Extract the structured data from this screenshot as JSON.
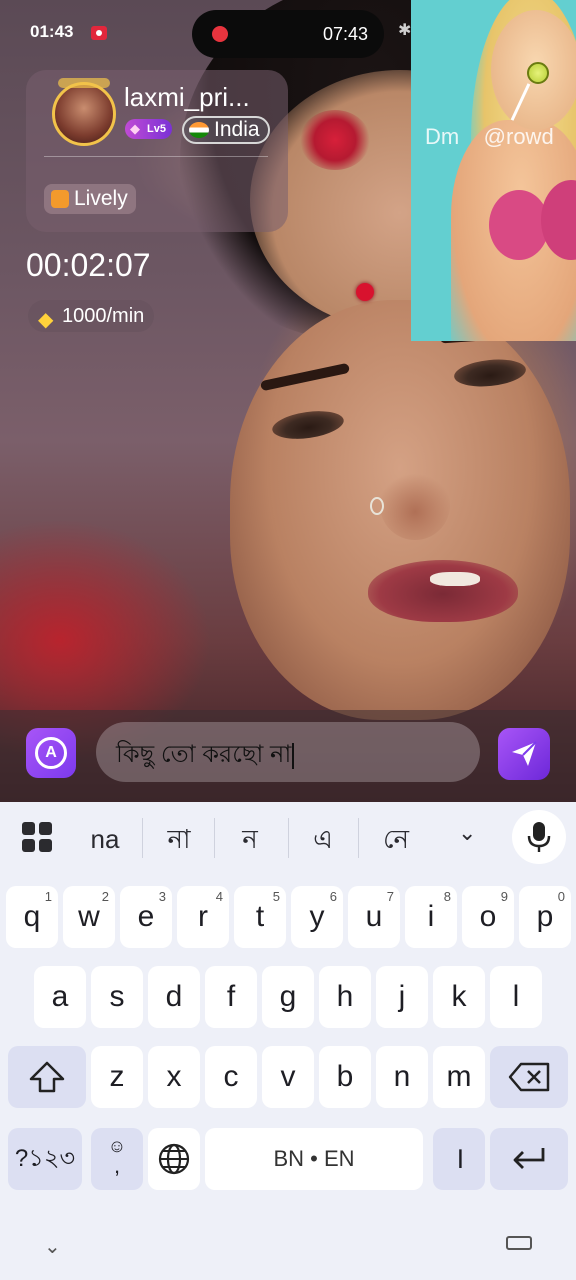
{
  "status_bar": {
    "time": "01:43",
    "call_time": "07:43"
  },
  "host": {
    "username": "laxmi_pri...",
    "level": "Lv5",
    "country": "India",
    "tag": "Lively"
  },
  "call": {
    "timer": "00:02:07",
    "rate": "1000/min"
  },
  "ad": {
    "overlay_text": "Dm    @rowd"
  },
  "input": {
    "text": "কিছু তো করছো না"
  },
  "keyboard": {
    "suggestions": [
      "na",
      "না",
      "ন",
      "এ",
      "নে"
    ],
    "row1": [
      {
        "k": "q",
        "n": "1"
      },
      {
        "k": "w",
        "n": "2"
      },
      {
        "k": "e",
        "n": "3"
      },
      {
        "k": "r",
        "n": "4"
      },
      {
        "k": "t",
        "n": "5"
      },
      {
        "k": "y",
        "n": "6"
      },
      {
        "k": "u",
        "n": "7"
      },
      {
        "k": "i",
        "n": "8"
      },
      {
        "k": "o",
        "n": "9"
      },
      {
        "k": "p",
        "n": "0"
      }
    ],
    "row2": [
      "a",
      "s",
      "d",
      "f",
      "g",
      "h",
      "j",
      "k",
      "l"
    ],
    "row3": [
      "z",
      "x",
      "c",
      "v",
      "b",
      "n",
      "m"
    ],
    "symbols_label": "?১২৩",
    "emoji_label": "☺",
    "comma_label": ",",
    "space_label": "BN • EN",
    "period_label": "।",
    "icons": [
      "apps-grid-icon",
      "chevron-down-icon",
      "mic-icon",
      "shift-icon",
      "backspace-icon",
      "globe-icon",
      "enter-icon",
      "translate-icon",
      "send-icon",
      "diamond-icon",
      "keyboard-icon"
    ]
  },
  "colors": {
    "accent": "#8b5cf6",
    "badge": "#c04bd4",
    "keyboard_bg": "#eef0f8"
  }
}
